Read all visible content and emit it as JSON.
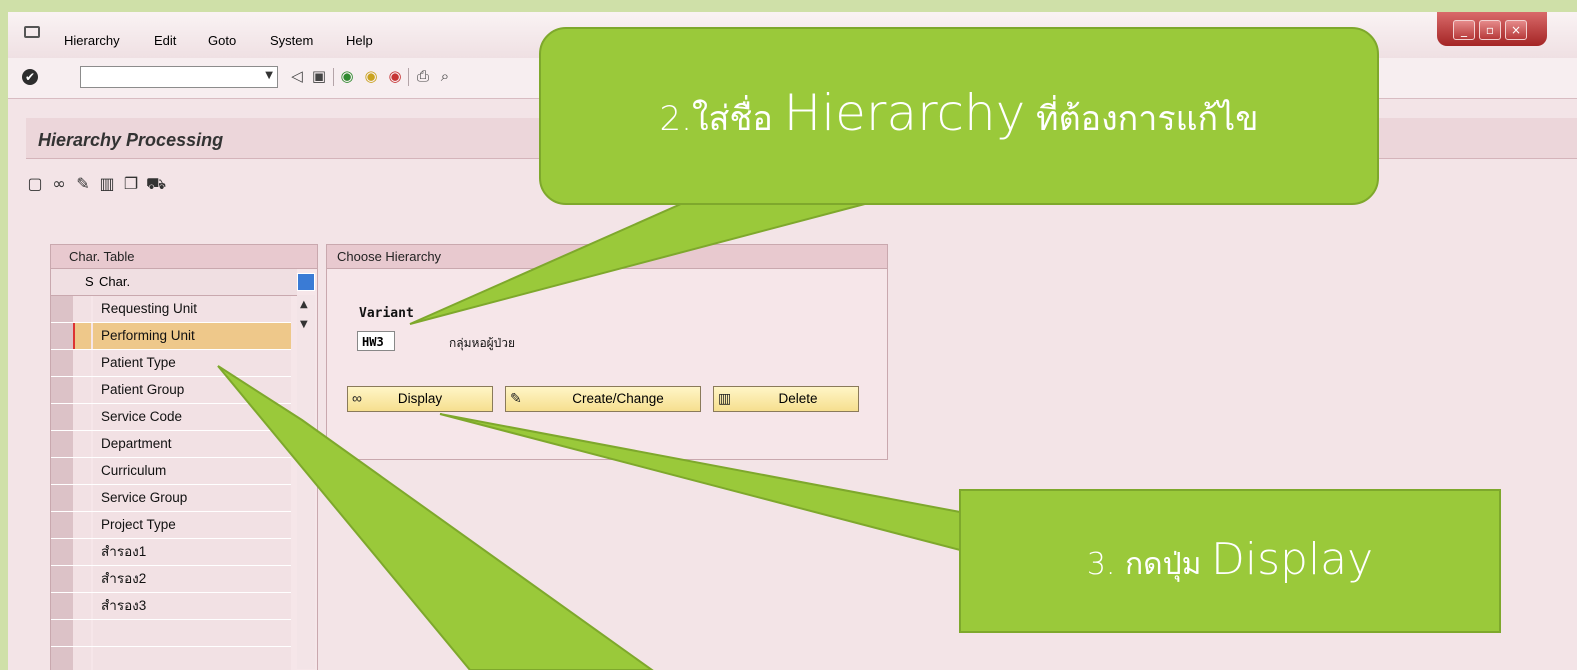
{
  "menubar": {
    "items": [
      "Hierarchy",
      "Edit",
      "Goto",
      "System",
      "Help"
    ],
    "window_controls": [
      "_",
      "▫",
      "×"
    ]
  },
  "toolbar": {
    "command_field_value": ""
  },
  "screen": {
    "title": "Hierarchy Processing"
  },
  "char_table": {
    "header": "Char. Table",
    "col_s": "S",
    "col_char": "Char.",
    "rows": [
      "Requesting Unit",
      "Performing Unit",
      "Patient Type",
      "Patient Group",
      "Service Code",
      "Department",
      "Curriculum",
      "Service Group",
      "Project Type",
      "สำรอง1",
      "สำรอง2",
      "สำรอง3",
      "",
      ""
    ],
    "selected_index": 1
  },
  "choose_hierarchy": {
    "header": "Choose Hierarchy",
    "variant_label": "Variant",
    "variant_value": "HW3",
    "variant_desc": "กลุ่มหอผู้ป่วย",
    "buttons": {
      "display": "Display",
      "create_change": "Create/Change",
      "delete": "Delete"
    }
  },
  "callouts": {
    "c2_prefix": "2.ใส่ชื่อ ",
    "c2_big": "Hierarchy",
    "c2_suffix": " ที่ต้องการแก้ไข",
    "c3_prefix": "3. กดปุ่ม ",
    "c3_big": "Display",
    "color": "#9ac93a"
  }
}
